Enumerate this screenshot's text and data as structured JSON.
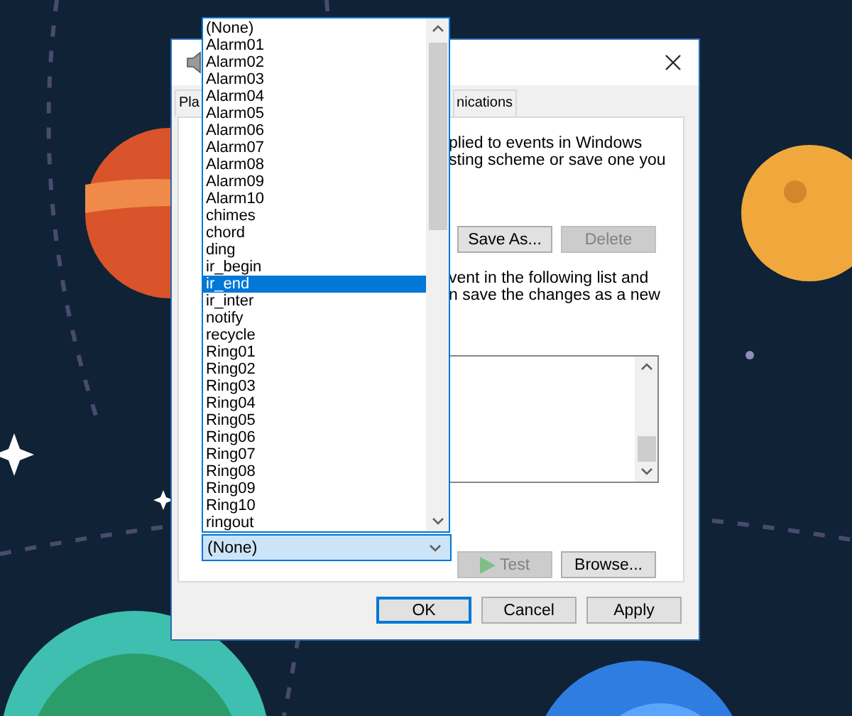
{
  "dialog": {
    "tabs": [
      {
        "label": "Pla",
        "selected": false
      },
      {
        "label": "nications",
        "selected": false
      }
    ],
    "description": [
      "plied to events in Windows",
      "sting scheme or save one you"
    ],
    "scheme_buttons": [
      {
        "label": "Save As...",
        "disabled": false
      },
      {
        "label": "Delete",
        "disabled": true
      }
    ],
    "instructions": [
      "vent in the following list and",
      "n save the changes as a new"
    ],
    "sound_select": {
      "value": "(None)",
      "expanded": true
    },
    "sound_buttons": [
      {
        "label": "Test",
        "kind": "play",
        "disabled": true
      },
      {
        "label": "Browse...",
        "kind": "plain",
        "disabled": false
      }
    ],
    "footer_buttons": [
      {
        "label": "OK",
        "default": true
      },
      {
        "label": "Cancel",
        "default": false
      },
      {
        "label": "Apply",
        "default": false
      }
    ]
  },
  "dropdown": {
    "items": [
      {
        "label": "(None)",
        "selected": false
      },
      {
        "label": "Alarm01",
        "selected": false
      },
      {
        "label": "Alarm02",
        "selected": false
      },
      {
        "label": "Alarm03",
        "selected": false
      },
      {
        "label": "Alarm04",
        "selected": false
      },
      {
        "label": "Alarm05",
        "selected": false
      },
      {
        "label": "Alarm06",
        "selected": false
      },
      {
        "label": "Alarm07",
        "selected": false
      },
      {
        "label": "Alarm08",
        "selected": false
      },
      {
        "label": "Alarm09",
        "selected": false
      },
      {
        "label": "Alarm10",
        "selected": false
      },
      {
        "label": "chimes",
        "selected": false
      },
      {
        "label": "chord",
        "selected": false
      },
      {
        "label": "ding",
        "selected": false
      },
      {
        "label": "ir_begin",
        "selected": false
      },
      {
        "label": "ir_end",
        "selected": true
      },
      {
        "label": "ir_inter",
        "selected": false
      },
      {
        "label": "notify",
        "selected": false
      },
      {
        "label": "recycle",
        "selected": false
      },
      {
        "label": "Ring01",
        "selected": false
      },
      {
        "label": "Ring02",
        "selected": false
      },
      {
        "label": "Ring03",
        "selected": false
      },
      {
        "label": "Ring04",
        "selected": false
      },
      {
        "label": "Ring05",
        "selected": false
      },
      {
        "label": "Ring06",
        "selected": false
      },
      {
        "label": "Ring07",
        "selected": false
      },
      {
        "label": "Ring08",
        "selected": false
      },
      {
        "label": "Ring09",
        "selected": false
      },
      {
        "label": "Ring10",
        "selected": false
      },
      {
        "label": "ringout",
        "selected": false
      }
    ]
  }
}
